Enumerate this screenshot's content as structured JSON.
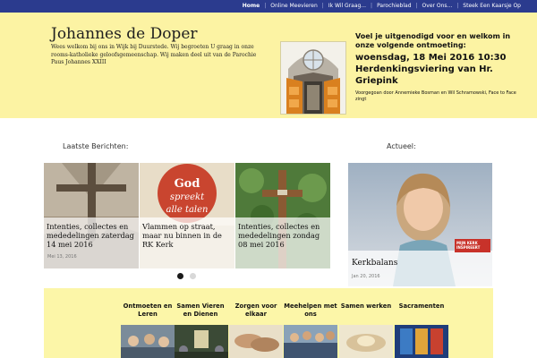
{
  "nav": {
    "items": [
      "Home",
      "Online Meevieren",
      "Ik Wil Graag...",
      "Parochieblad",
      "Over Ons...",
      "Steek Een Kaarsje Op"
    ]
  },
  "header": {
    "title": "Johannes de Doper",
    "description": "Wees welkom bij ons in Wijk bij Duurstede. Wij begroeten U graag in onze rooms-katholieke geloofsgemeenschap. Wij maken deel uit van de Parochie Paus Johannes XXIII",
    "invite_lead": "Voel je uitgenodigd voor en welkom in onze volgende ontmoeting:",
    "invite_date": "woensdag, 18 Mei 2016 10:30 Herdenkingsviering van Hr. Griepink",
    "invite_note": "Voorgegoan door Annemieke Bosman en Wil Schramowski, Face to Face zingt"
  },
  "sections": {
    "latest_title": "Laatste Berichten:",
    "current_title": "Actueel:"
  },
  "slides": [
    {
      "title": "Intenties, collectes en mededelingen zaterdag 14 mei 2016",
      "meta": "Mei 13, 2016"
    },
    {
      "title": "Vlammen op straat, maar nu binnen in de RK Kerk",
      "meta": ""
    },
    {
      "title": "Intenties, collectes en mededelingen zondag 08 mei 2016",
      "meta": ""
    }
  ],
  "featured": {
    "title": "Kerkbalans",
    "meta": "Jan 20, 2016",
    "badge": "MIJN KERK INSPIREERT"
  },
  "categories": [
    "Ontmoeten en Leren",
    "Samen Vieren en Dienen",
    "Zorgen voor elkaar",
    "Meehelpen met ons",
    "Samen werken",
    "Sacramenten"
  ],
  "colors": {
    "nav_bg": "#2b3b8e",
    "header_bg": "#fcf3a3",
    "bottom_bg": "#fcf6a8"
  }
}
